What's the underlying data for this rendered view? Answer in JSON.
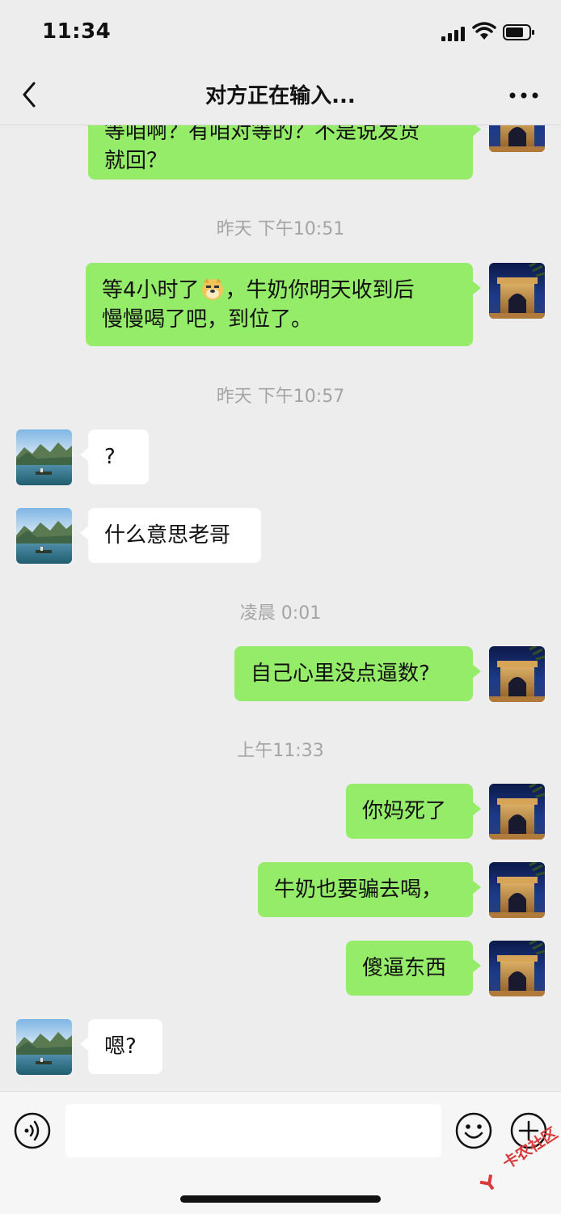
{
  "status_bar": {
    "time": "11:34"
  },
  "nav": {
    "title": "对方正在输入..."
  },
  "messages": [
    {
      "side": "me",
      "text_line1": "等咱啊？有咱对等的？不是说发货",
      "text_line2": "就回？"
    },
    {
      "timestamp": "昨天 下午10:51"
    },
    {
      "side": "me",
      "text_before_emoji": "等4小时了",
      "emoji": "doge-emoji",
      "text_after_emoji": "，牛奶你明天收到后",
      "text_line2": "慢慢喝了吧，到位了。"
    },
    {
      "timestamp": "昨天 下午10:57"
    },
    {
      "side": "them",
      "text": "?"
    },
    {
      "side": "them",
      "text": "什么意思老哥"
    },
    {
      "timestamp": "凌晨 0:01"
    },
    {
      "side": "me",
      "text": "自己心里没点逼数?"
    },
    {
      "timestamp": "上午11:33"
    },
    {
      "side": "me",
      "text": "你妈死了"
    },
    {
      "side": "me",
      "text": "牛奶也要骗去喝，"
    },
    {
      "side": "me",
      "text": "傻逼东西"
    },
    {
      "side": "them",
      "text": "嗯?"
    }
  ],
  "input_bar": {
    "placeholder": ""
  },
  "watermark": {
    "text": "卡农社区"
  },
  "colors": {
    "my_bubble": "#95ec69",
    "their_bubble": "#ffffff",
    "background": "#ededed",
    "timestamp": "#a4a4a4"
  }
}
